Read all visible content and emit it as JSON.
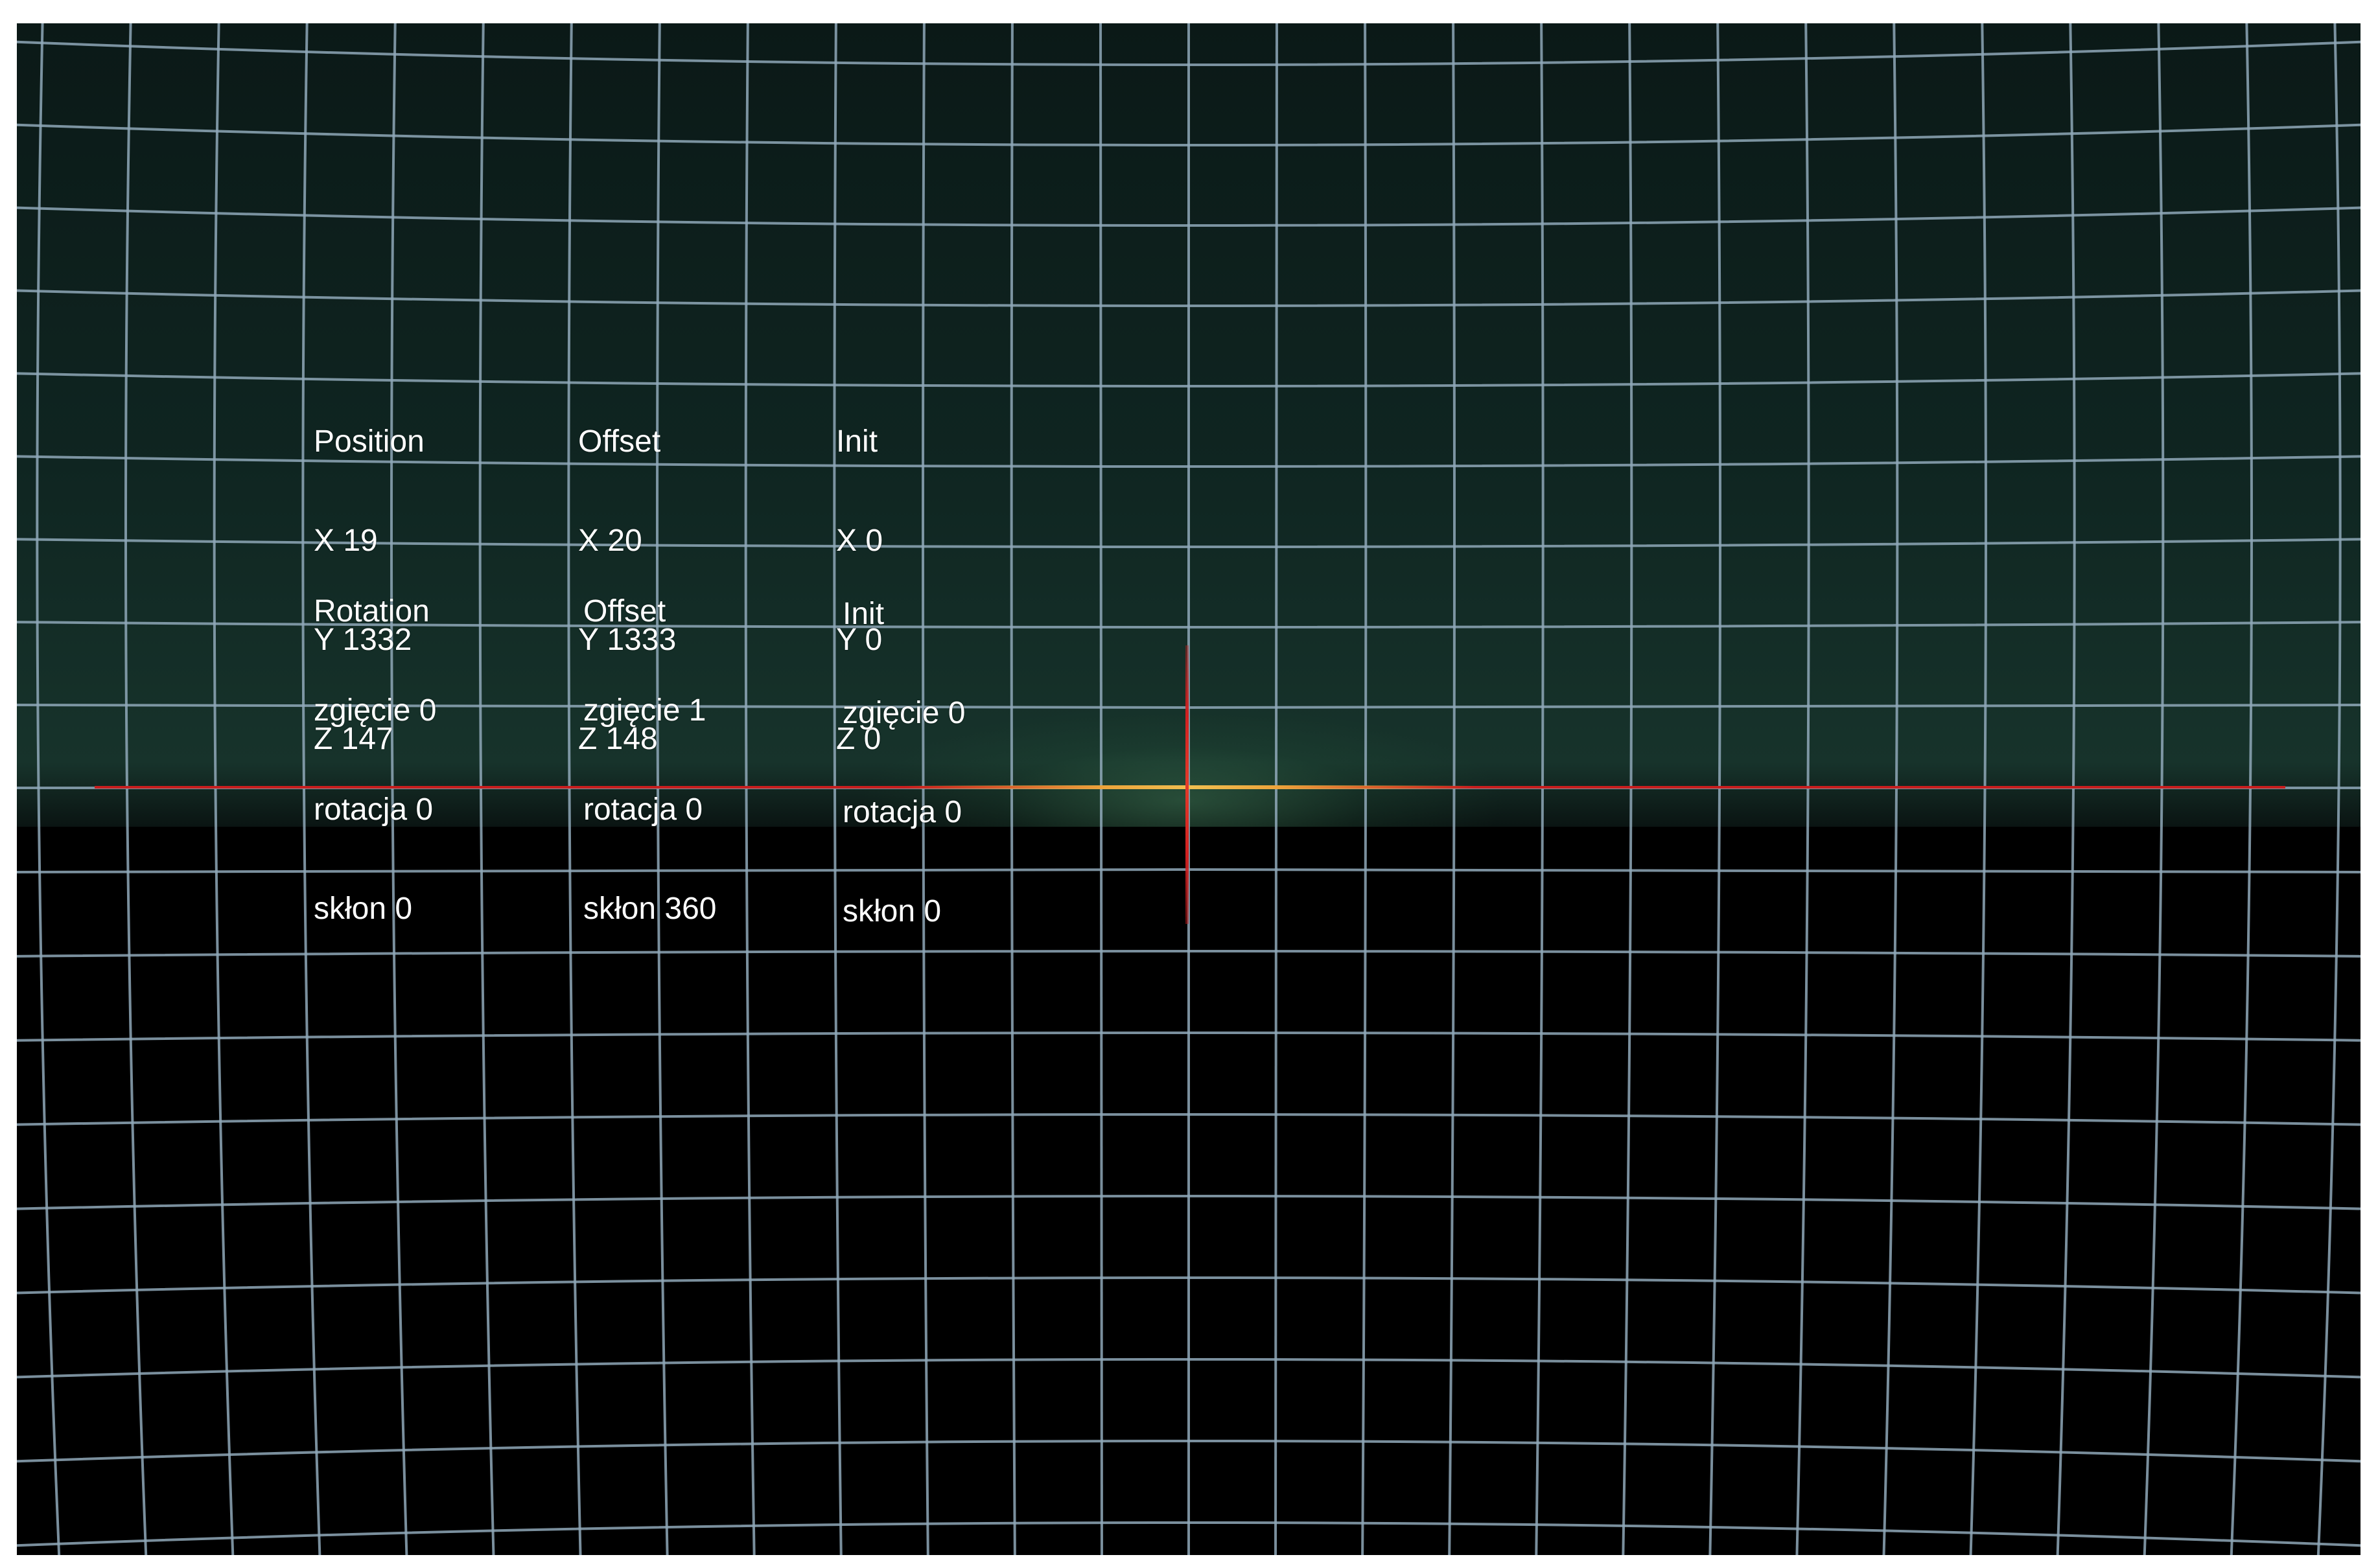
{
  "position_block": {
    "position": {
      "heading": "Position",
      "x": "X 19",
      "y": "Y 1332",
      "z": "Z 147"
    },
    "offset": {
      "heading": "Offset",
      "x": "X 20",
      "y": "Y 1333",
      "z": "Z 148"
    },
    "init": {
      "heading": "Init",
      "x": "X 0",
      "y": "Y 0",
      "z": "Z 0"
    }
  },
  "rotation_block": {
    "rotation": {
      "heading": "Rotation",
      "bend": "zgięcie 0",
      "rotate": "rotacja 0",
      "tilt": "skłon 0"
    },
    "offset": {
      "heading": "Offset",
      "bend": "zgięcie 1",
      "rotate": "rotacja 0",
      "tilt": "skłon 360"
    },
    "init": {
      "heading": "Init",
      "bend": "zgięcie 0",
      "rotate": "rotacja 0",
      "tilt": "skłon 0"
    }
  },
  "colors": {
    "grid": "#8fa8b8",
    "horizon": "#c81e1e",
    "crosshair": "#d22020",
    "sky": "#0f2521",
    "ground": "#000000",
    "text": "#ffffff"
  }
}
